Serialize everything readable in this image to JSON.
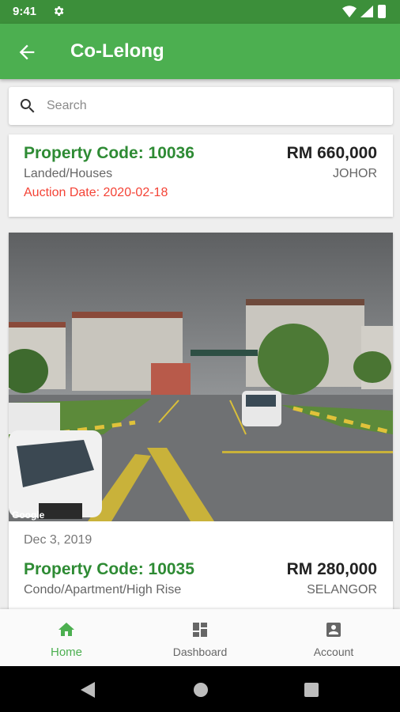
{
  "status_bar": {
    "time": "9:41"
  },
  "app_bar": {
    "title": "Co-Lelong"
  },
  "search": {
    "placeholder": "Search"
  },
  "listings": [
    {
      "code": "Property Code: 10036",
      "price": "RM 660,000",
      "type": "Landed/Houses",
      "state": "JOHOR",
      "auction_date": "Auction Date: 2020-02-18"
    },
    {
      "date": "Dec 3, 2019",
      "code": "Property Code: 10035",
      "price": "RM 280,000",
      "type": "Condo/Apartment/High Rise",
      "state": "SELANGOR",
      "image_watermark": "Google"
    }
  ],
  "bottom_nav": [
    {
      "label": "Home",
      "icon": "home-icon",
      "active": true
    },
    {
      "label": "Dashboard",
      "icon": "dashboard-icon",
      "active": false
    },
    {
      "label": "Account",
      "icon": "account-icon",
      "active": false
    }
  ],
  "colors": {
    "primary": "#4caf50",
    "primary_dark": "#3c8f3a",
    "code_text": "#2e8b34",
    "auction_text": "#f44336"
  }
}
